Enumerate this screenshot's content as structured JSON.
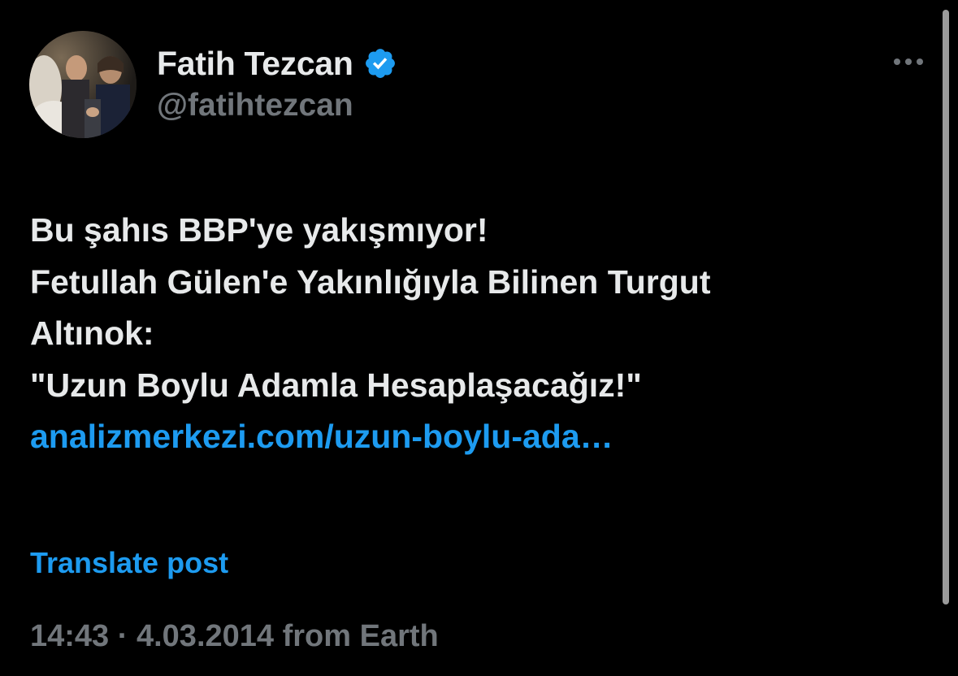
{
  "tweet": {
    "author": {
      "display_name": "Fatih Tezcan",
      "handle": "@fatihtezcan",
      "avatar_icon": "avatar-photo",
      "verified": true,
      "verified_icon": "verified-badge-icon",
      "verified_color": "#1d9bf0"
    },
    "more_icon": "more-horizontal-icon",
    "text_lines": [
      "Bu şahıs BBP'ye yakışmıyor!",
      "Fetullah Gülen'e Yakınlığıyla Bilinen Turgut",
      "Altınok:",
      "\"Uzun Boylu Adamla Hesaplaşacağız!\""
    ],
    "link_text": "analizmerkezi.com/uzun-boylu-ada…",
    "translate_label": "Translate post",
    "meta": {
      "time": "14:43",
      "separator": "·",
      "date": "4.03.2014",
      "source": "from Earth"
    }
  },
  "colors": {
    "background": "#000000",
    "primary_text": "#e7e9ea",
    "secondary_text": "#71767b",
    "accent": "#1d9bf0"
  }
}
